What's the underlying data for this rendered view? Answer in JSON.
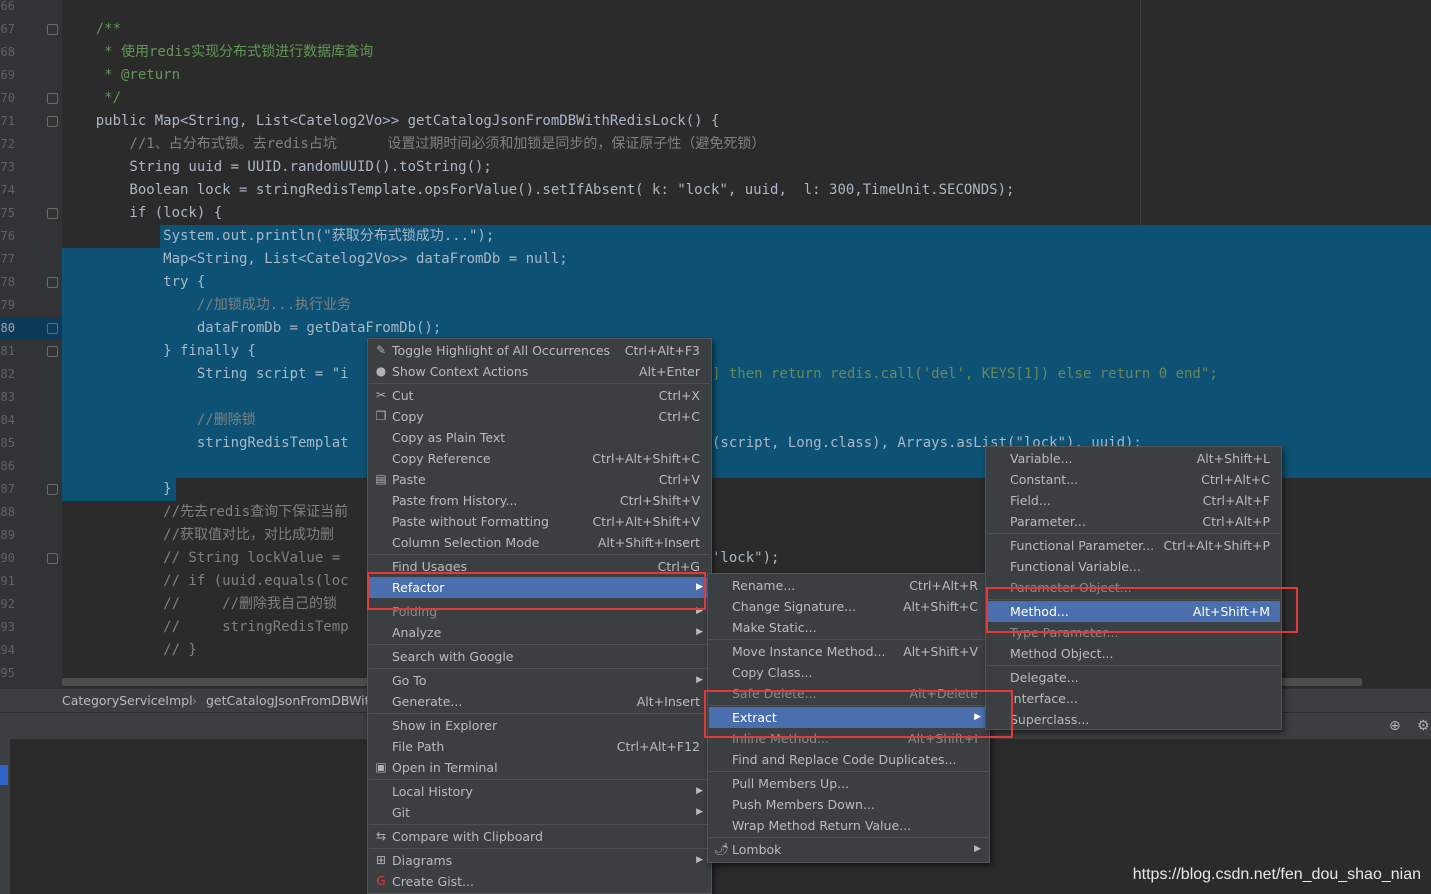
{
  "editor": {
    "line_numbers": [
      "66",
      "67",
      "68",
      "69",
      "70",
      "71",
      "72",
      "73",
      "74",
      "75",
      "76",
      "77",
      "78",
      "79",
      "80",
      "81",
      "82",
      "83",
      "84",
      "85",
      "86",
      "87",
      "88",
      "89",
      "90",
      "91",
      "92",
      "93",
      "94",
      "95"
    ],
    "current_line": "80",
    "code_lines": [
      "",
      "    /**",
      "     * 使用redis实现分布式锁进行数据库查询",
      "     * @return",
      "     */",
      "    public Map<String, List<Catelog2Vo>> getCatalogJsonFromDBWithRedisLock() {",
      "        //1、占分布式锁。去redis占坑      设置过期时间必须和加锁是同步的，保证原子性（避免死锁）",
      "        String uuid = UUID.randomUUID().toString();",
      "        Boolean lock = stringRedisTemplate.opsForValue().setIfAbsent( k: \"lock\", uuid,  l: 300,TimeUnit.SECONDS);",
      "        if (lock) {",
      "            System.out.println(\"获取分布式锁成功...\");",
      "            Map<String, List<Catelog2Vo>> dataFromDb = null;",
      "            try {",
      "                //加锁成功...执行业务",
      "                dataFromDb = getDataFromDb();",
      "            } finally {",
      "                String script = \"i",
      "",
      "                //删除锁",
      "                stringRedisTemplat",
      "",
      "            }",
      "            //先去redis查询下保证当前",
      "            //获取值对比，对比成功删",
      "            // String lockValue = ",
      "            // if (uuid.equals(loc",
      "            //     //删除我自己的锁",
      "            //     stringRedisTemp",
      "            // }",
      ""
    ],
    "right_fragments": [
      {
        "line": 16,
        "text": "] then return redis.call('del', KEYS[1]) else return 0 end\";"
      },
      {
        "line": 19,
        "text": "(script, Long.class), Arrays.asList(\"lock\"), uuid);"
      },
      {
        "line": 24,
        "text": "'lock\");"
      }
    ]
  },
  "breadcrumb": {
    "class_name": "CategoryServiceImpl",
    "separator": "›",
    "method_name": "getCatalogJsonFromDBWith"
  },
  "context_menu": {
    "items": [
      {
        "label": "Toggle Highlight of All Occurrences",
        "shortcut": "Ctrl+Alt+F3",
        "icon": "highlight-icon"
      },
      {
        "label": "Show Context Actions",
        "shortcut": "Alt+Enter",
        "icon": "bulb-icon"
      },
      {
        "label": "Cut",
        "shortcut": "Ctrl+X",
        "icon": "scissors-icon"
      },
      {
        "label": "Copy",
        "shortcut": "Ctrl+C",
        "icon": "copy-icon"
      },
      {
        "label": "Copy as Plain Text",
        "shortcut": ""
      },
      {
        "label": "Copy Reference",
        "shortcut": "Ctrl+Alt+Shift+C"
      },
      {
        "label": "Paste",
        "shortcut": "Ctrl+V",
        "icon": "paste-icon"
      },
      {
        "label": "Paste from History...",
        "shortcut": "Ctrl+Shift+V"
      },
      {
        "label": "Paste without Formatting",
        "shortcut": "Ctrl+Alt+Shift+V"
      },
      {
        "label": "Column Selection Mode",
        "shortcut": "Alt+Shift+Insert"
      },
      {
        "label": "Find Usages",
        "shortcut": "Ctrl+G"
      },
      {
        "label": "Refactor",
        "shortcut": ""
      },
      {
        "label": "Folding",
        "shortcut": ""
      },
      {
        "label": "Analyze",
        "shortcut": ""
      },
      {
        "label": "Search with Google",
        "shortcut": ""
      },
      {
        "label": "Go To",
        "shortcut": ""
      },
      {
        "label": "Generate...",
        "shortcut": "Alt+Insert"
      },
      {
        "label": "Show in Explorer",
        "shortcut": ""
      },
      {
        "label": "File Path",
        "shortcut": "Ctrl+Alt+F12"
      },
      {
        "label": "Open in Terminal",
        "shortcut": "",
        "icon": "terminal-icon"
      },
      {
        "label": "Local History",
        "shortcut": ""
      },
      {
        "label": "Git",
        "shortcut": ""
      },
      {
        "label": "Compare with Clipboard",
        "shortcut": "",
        "icon": "compare-icon"
      },
      {
        "label": "Diagrams",
        "shortcut": "",
        "icon": "diagram-icon"
      },
      {
        "label": "Create Gist...",
        "shortcut": "",
        "icon": "gist-icon"
      }
    ]
  },
  "refactor_menu": {
    "items": [
      {
        "label": "Rename...",
        "shortcut": "Ctrl+Alt+R"
      },
      {
        "label": "Change Signature...",
        "shortcut": "Alt+Shift+C"
      },
      {
        "label": "Make Static...",
        "shortcut": ""
      },
      {
        "label": "Move Instance Method...",
        "shortcut": "Alt+Shift+V"
      },
      {
        "label": "Copy Class...",
        "shortcut": ""
      },
      {
        "label": "Safe Delete...",
        "shortcut": "Alt+Delete"
      },
      {
        "label": "Extract",
        "shortcut": ""
      },
      {
        "label": "Inline Method...",
        "shortcut": "Alt+Shift+I"
      },
      {
        "label": "Find and Replace Code Duplicates...",
        "shortcut": ""
      },
      {
        "label": "Pull Members Up...",
        "shortcut": ""
      },
      {
        "label": "Push Members Down...",
        "shortcut": ""
      },
      {
        "label": "Wrap Method Return Value...",
        "shortcut": ""
      },
      {
        "label": "Lombok",
        "shortcut": "",
        "icon": "lombok-icon"
      }
    ]
  },
  "extract_menu": {
    "items": [
      {
        "label": "Variable...",
        "shortcut": "Alt+Shift+L"
      },
      {
        "label": "Constant...",
        "shortcut": "Ctrl+Alt+C"
      },
      {
        "label": "Field...",
        "shortcut": "Ctrl+Alt+F"
      },
      {
        "label": "Parameter...",
        "shortcut": "Ctrl+Alt+P"
      },
      {
        "label": "Functional Parameter...",
        "shortcut": "Ctrl+Alt+Shift+P"
      },
      {
        "label": "Functional Variable...",
        "shortcut": ""
      },
      {
        "label": "Parameter Object...",
        "shortcut": ""
      },
      {
        "label": "Method...",
        "shortcut": "Alt+Shift+M"
      },
      {
        "label": "Type Parameter...",
        "shortcut": ""
      },
      {
        "label": "Method Object...",
        "shortcut": ""
      },
      {
        "label": "Delegate...",
        "shortcut": ""
      },
      {
        "label": "Interface...",
        "shortcut": ""
      },
      {
        "label": "Superclass...",
        "shortcut": ""
      }
    ]
  },
  "watermark": "https://blog.csdn.net/fen_dou_shao_nian",
  "colors": {
    "editor_bg": "#2b2b2b",
    "selection": "#0d5274",
    "menu_bg": "#3c3f41",
    "menu_active": "#4b6eaf",
    "annotation_box": "#e03a3a",
    "comment": "#629755",
    "keyword": "#cc7832",
    "string": "#6a8759",
    "method": "#ffc66d",
    "field": "#9876aa"
  }
}
